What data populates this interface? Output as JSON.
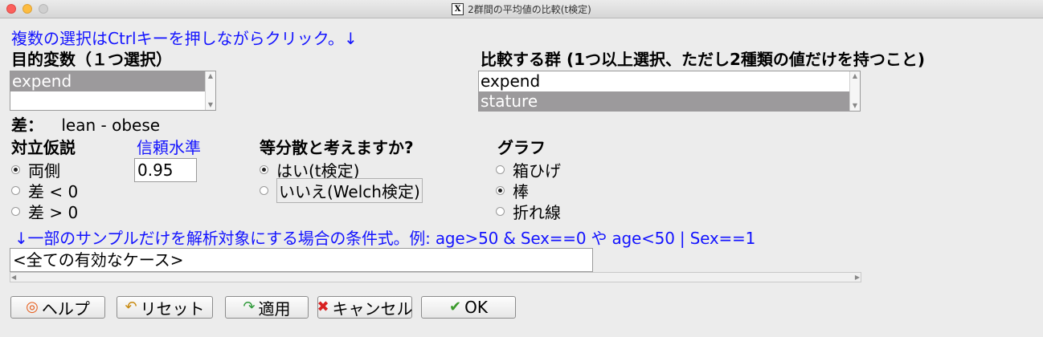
{
  "window": {
    "title": "2群間の平均値の比較(t検定)",
    "icon": "x11-icon"
  },
  "instruction": "複数の選択はCtrlキーを押しながらクリック。↓",
  "response": {
    "label": "目的変数（１つ選択）",
    "items": [
      {
        "label": "expend",
        "selected": true
      },
      {
        "label": "",
        "selected": false
      }
    ]
  },
  "groups": {
    "label": "比較する群 (1つ以上選択、ただし2種類の値だけを持つこと)",
    "items": [
      {
        "label": "expend",
        "selected": false
      },
      {
        "label": "stature",
        "selected": true
      }
    ]
  },
  "difference": {
    "label": "差：",
    "value": "lean - obese"
  },
  "alternative": {
    "label": "対立仮説",
    "options": [
      {
        "label": "両側",
        "checked": true
      },
      {
        "label": "差 < 0",
        "checked": false
      },
      {
        "label": "差 > 0",
        "checked": false
      }
    ]
  },
  "confidence": {
    "label": "信頼水準",
    "value": "0.95"
  },
  "variance": {
    "label": "等分散と考えますか?",
    "options": [
      {
        "label": "はい(t検定)",
        "checked": true
      },
      {
        "label": "いいえ(Welch検定)",
        "checked": false
      }
    ]
  },
  "graph": {
    "label": "グラフ",
    "options": [
      {
        "label": "箱ひげ",
        "checked": false
      },
      {
        "label": "棒",
        "checked": true
      },
      {
        "label": "折れ線",
        "checked": false
      }
    ]
  },
  "subset": {
    "label": "↓一部のサンプルだけを解析対象にする場合の条件式。例: age>50 & Sex==0 や age<50 | Sex==1",
    "value": "<全ての有効なケース>"
  },
  "buttons": {
    "help": {
      "label": "ヘルプ",
      "icon": "lifebuoy-icon"
    },
    "reset": {
      "label": "リセット",
      "icon": "undo-arrow-icon"
    },
    "apply": {
      "label": "適用",
      "icon": "redo-arrow-icon"
    },
    "cancel": {
      "label": "キャンセル",
      "icon": "red-x-icon"
    },
    "ok": {
      "label": "OK",
      "icon": "checkmark-icon"
    }
  },
  "colors": {
    "selection": "#9c9a9c",
    "blue_text": "#1414ff",
    "cancel_icon": "#d82020",
    "ok_icon": "#3a9a2a",
    "apply_icon": "#2f9a3a",
    "reset_icon": "#c88a10",
    "help_icon": "#e65c1a"
  }
}
